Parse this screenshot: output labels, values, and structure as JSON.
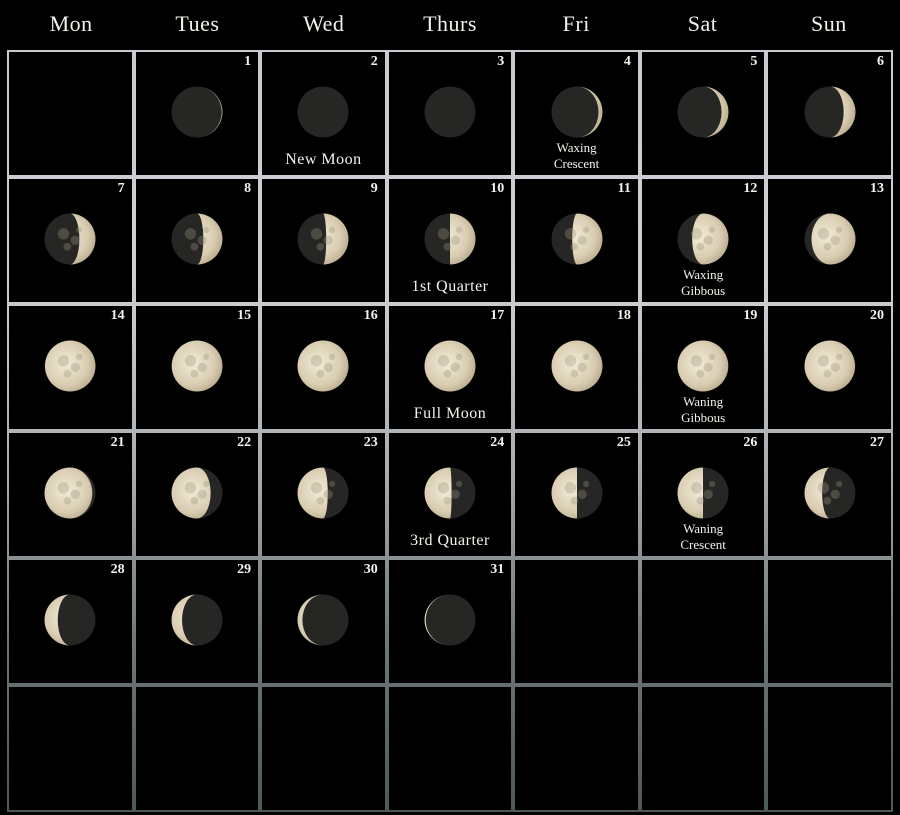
{
  "weekdays": [
    "Mon",
    "Tues",
    "Wed",
    "Thurs",
    "Fri",
    "Sat",
    "Sun"
  ],
  "colors": {
    "background": "#000000",
    "grid_line_top": "#cfcfd4",
    "grid_line_bottom": "#4d5859",
    "moon_lit": "#e6dcc4",
    "moon_dark": "#262625",
    "text": "#f4f2ec"
  },
  "calendar": {
    "leading_blank_days": 1,
    "days": [
      {
        "day": "1",
        "phase": 0.04,
        "label": ""
      },
      {
        "day": "2",
        "phase": 0.0,
        "label": "New Moon"
      },
      {
        "day": "3",
        "phase": 0.0,
        "label": ""
      },
      {
        "day": "4",
        "phase": 0.09,
        "label": "Waxing Crescent"
      },
      {
        "day": "5",
        "phase": 0.12,
        "label": ""
      },
      {
        "day": "6",
        "phase": 0.16,
        "label": ""
      },
      {
        "day": "7",
        "phase": 0.19,
        "label": ""
      },
      {
        "day": "8",
        "phase": 0.21,
        "label": ""
      },
      {
        "day": "9",
        "phase": 0.23,
        "label": ""
      },
      {
        "day": "10",
        "phase": 0.25,
        "label": "1st Quarter"
      },
      {
        "day": "11",
        "phase": 0.28,
        "label": ""
      },
      {
        "day": "12",
        "phase": 0.32,
        "label": "Waxing Gibbous"
      },
      {
        "day": "13",
        "phase": 0.38,
        "label": ""
      },
      {
        "day": "14",
        "phase": 0.47,
        "label": ""
      },
      {
        "day": "15",
        "phase": 0.48,
        "label": ""
      },
      {
        "day": "16",
        "phase": 0.5,
        "label": ""
      },
      {
        "day": "17",
        "phase": 0.5,
        "label": "Full Moon"
      },
      {
        "day": "18",
        "phase": 0.5,
        "label": ""
      },
      {
        "day": "19",
        "phase": 0.52,
        "label": "Waning Gibbous"
      },
      {
        "day": "20",
        "phase": 0.53,
        "label": ""
      },
      {
        "day": "21",
        "phase": 0.58,
        "label": ""
      },
      {
        "day": "22",
        "phase": 0.66,
        "label": ""
      },
      {
        "day": "23",
        "phase": 0.72,
        "label": ""
      },
      {
        "day": "24",
        "phase": 0.74,
        "label": "3rd Quarter"
      },
      {
        "day": "25",
        "phase": 0.75,
        "label": ""
      },
      {
        "day": "26",
        "phase": 0.75,
        "label": "Waning Crescent"
      },
      {
        "day": "27",
        "phase": 0.8,
        "label": ""
      },
      {
        "day": "28",
        "phase": 0.83,
        "label": ""
      },
      {
        "day": "29",
        "phase": 0.85,
        "label": ""
      },
      {
        "day": "30",
        "phase": 0.9,
        "label": ""
      },
      {
        "day": "31",
        "phase": 0.95,
        "label": ""
      }
    ],
    "total_cells": 42
  }
}
